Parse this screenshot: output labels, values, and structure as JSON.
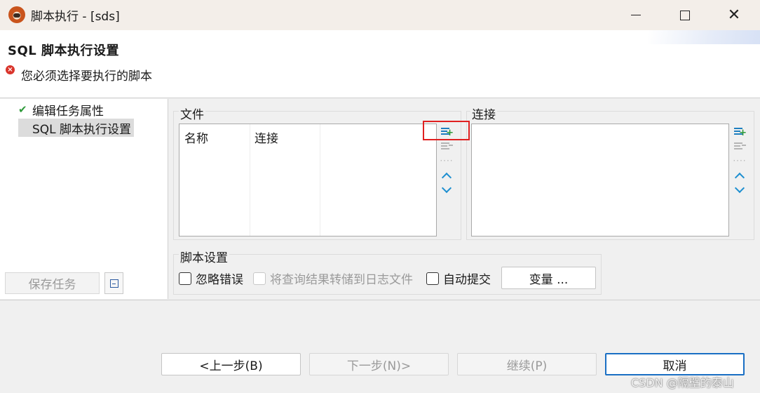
{
  "window": {
    "title": "脚本执行 - [sds]"
  },
  "header": {
    "title": "SQL 脚本执行设置",
    "error_message": "您必须选择要执行的脚本"
  },
  "sidebar": {
    "items": [
      {
        "label": "编辑任务属性",
        "status": "done"
      },
      {
        "label": "SQL 脚本执行设置",
        "status": "current"
      }
    ],
    "save_task_label": "保存任务"
  },
  "files": {
    "label": "文件",
    "columns": [
      "名称",
      "连接"
    ]
  },
  "connections": {
    "label": "连接"
  },
  "script_settings": {
    "label": "脚本设置",
    "options": [
      {
        "label": "忽略错误",
        "checked": false,
        "enabled": true
      },
      {
        "label": "将查询结果转储到日志文件",
        "checked": false,
        "enabled": false
      },
      {
        "label": "自动提交",
        "checked": false,
        "enabled": true
      }
    ],
    "variables_label": "变量 ..."
  },
  "footer": {
    "back_label": "<上一步(B)",
    "next_label": "下一步(N)>",
    "continue_label": "继续(P)",
    "cancel_label": "取消"
  },
  "watermark": "CSDN @隔壁的泰山",
  "colors": {
    "accent": "#1a6fc4",
    "error": "#d9342b",
    "highlight": "#e02020",
    "success": "#2e9a3a"
  }
}
